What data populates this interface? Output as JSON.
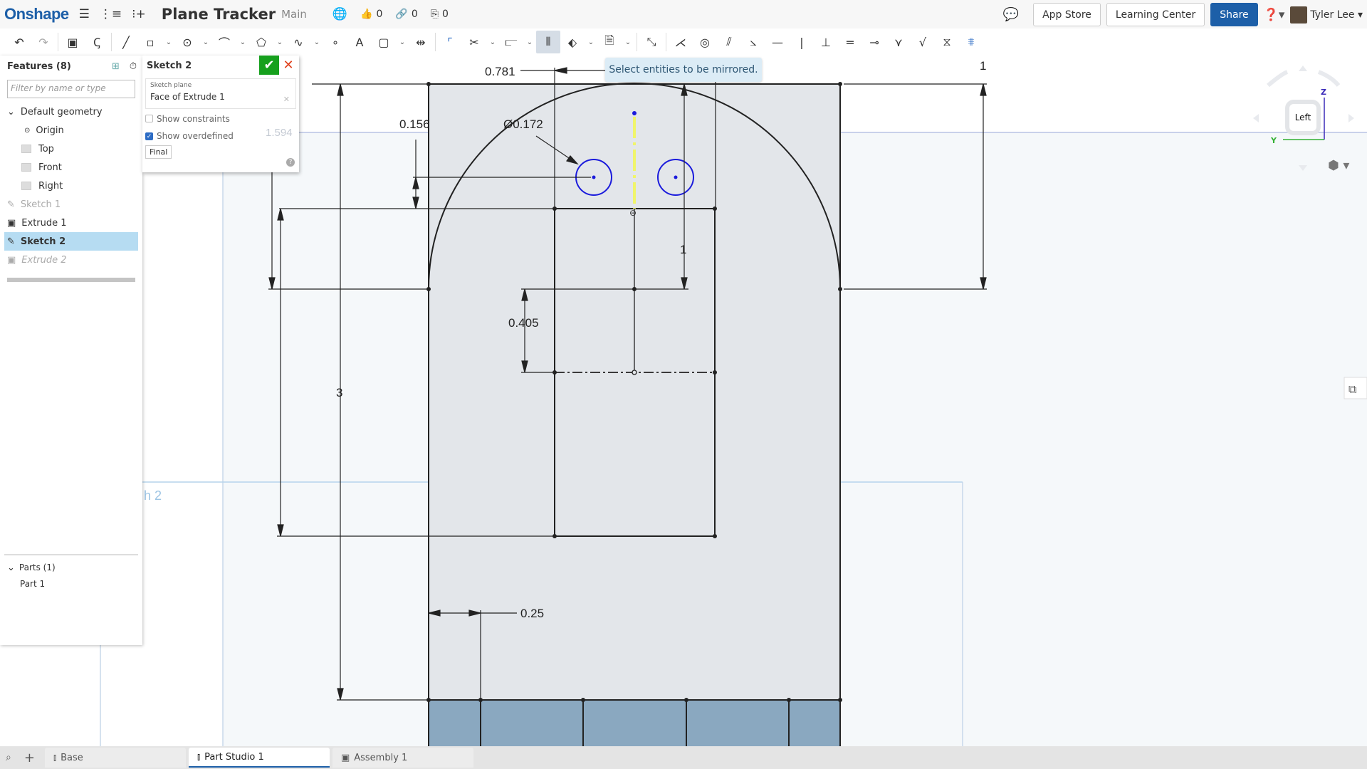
{
  "app": {
    "brand": "Onshape",
    "document_title": "Plane Tracker",
    "branch": "Main",
    "likes": "0",
    "links": "0",
    "copies": "0"
  },
  "header": {
    "app_store": "App Store",
    "learning_center": "Learning Center",
    "share": "Share",
    "user": "Tyler Lee"
  },
  "features": {
    "title": "Features (8)",
    "filter_placeholder": "Filter by name or type",
    "group": "Default geometry",
    "items": [
      {
        "label": "Origin"
      },
      {
        "label": "Top"
      },
      {
        "label": "Front"
      },
      {
        "label": "Right"
      },
      {
        "label": "Sketch 1"
      },
      {
        "label": "Extrude 1"
      },
      {
        "label": "Sketch 2"
      },
      {
        "label": "Extrude 2"
      }
    ],
    "parts_title": "Parts (1)",
    "parts": [
      {
        "label": "Part 1"
      }
    ]
  },
  "sketch_dialog": {
    "title": "Sketch 2",
    "plane_label": "Sketch plane",
    "plane_value": "Face of Extrude 1",
    "show_constraints": "Show constraints",
    "show_overdefined": "Show overdefined",
    "final": "Final"
  },
  "tooltip": "Select entities to be mirrored.",
  "dimensions": {
    "d_0781": "0.781",
    "d_1_right": "1",
    "d_0156": "0.156",
    "d_dia": "Ø0.172",
    "d_1_inner": "1",
    "d_0405": "0.405",
    "d_3": "3",
    "d_025": "0.25",
    "ghost_label": "h 2",
    "ghost_dim": "1.594"
  },
  "viewcube": {
    "face": "Left",
    "z": "Z",
    "y": "Y"
  },
  "tabs": [
    {
      "label": "Base"
    },
    {
      "label": "Part Studio 1"
    },
    {
      "label": "Assembly 1"
    }
  ],
  "colors": {
    "accent": "#1d5fa8",
    "sketch_blue": "#1a1adc",
    "mirror_yellow": "#f0f56a",
    "face_fill": "#e3e6ea",
    "extrude_fill": "#8aa8c0"
  }
}
